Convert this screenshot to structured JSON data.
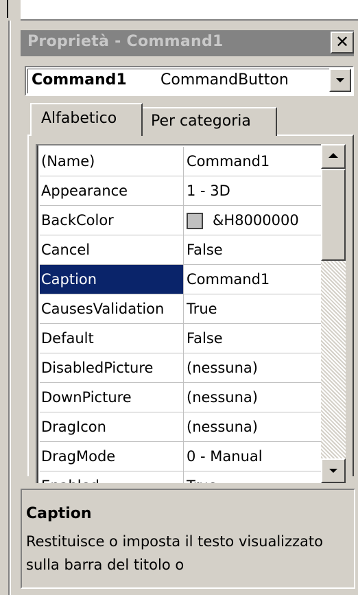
{
  "window": {
    "title": "Proprietà - Command1",
    "close_glyph": "✕"
  },
  "object_selector": {
    "name": "Command1",
    "type": "CommandButton"
  },
  "tabs": [
    {
      "label": "Alfabetico",
      "active": true
    },
    {
      "label": "Per categoria",
      "active": false
    }
  ],
  "properties": [
    {
      "name": "(Name)",
      "value": "Command1"
    },
    {
      "name": "Appearance",
      "value": "1 - 3D"
    },
    {
      "name": "BackColor",
      "value": "&H8000000",
      "swatch_color": "#c0c0c0"
    },
    {
      "name": "Cancel",
      "value": "False"
    },
    {
      "name": "Caption",
      "value": "Command1",
      "selected": true
    },
    {
      "name": "CausesValidation",
      "value": "True"
    },
    {
      "name": "Default",
      "value": "False"
    },
    {
      "name": "DisabledPicture",
      "value": "(nessuna)"
    },
    {
      "name": "DownPicture",
      "value": "(nessuna)"
    },
    {
      "name": "DragIcon",
      "value": "(nessuna)"
    },
    {
      "name": "DragMode",
      "value": "0 - Manual"
    },
    {
      "name": "Enabled",
      "value": "True"
    }
  ],
  "description": {
    "title": "Caption",
    "text": "Restituisce o imposta il testo visualizzato sulla barra del titolo o"
  },
  "colors": {
    "title_bar": "#838383",
    "selection": "#0a246a",
    "face": "#d4d0c8"
  }
}
